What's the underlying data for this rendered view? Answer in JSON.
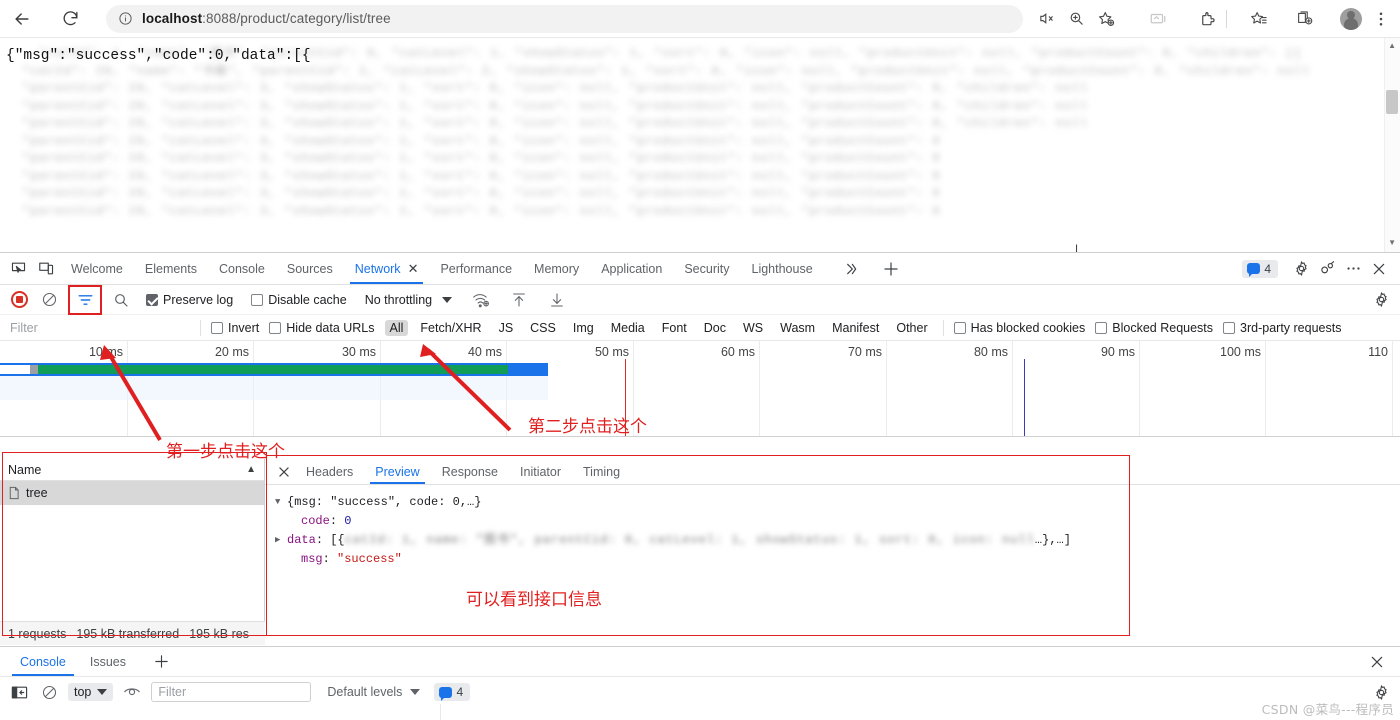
{
  "browser": {
    "back_icon": "back-arrow-icon",
    "reload_icon": "reload-icon",
    "address": {
      "info_icon": "info-circle-icon",
      "host": "localhost",
      "path": ":8088/product/category/list/tree",
      "full": "localhost:8088/product/category/list/tree"
    },
    "right_icons": [
      "read-aloud-icon",
      "zoom-icon",
      "add-favorite-icon",
      "collections-icon",
      "extensions-icon",
      "favorites-icon",
      "browser-essentials-icon",
      "profile-avatar-icon",
      "settings-more-icon"
    ]
  },
  "page": {
    "json_first_line": "{\"msg\":\"success\",\"code\":0,\"data\":[{",
    "blurred_lines": [
      "  \"catId\": 1, \"name\": \"图书\", \"parentCid\": 0, \"catLevel\": 1, \"showStatus\": 1, \"sort\": 0, \"icon\": null, \"productUnit\": null, \"productCount\": 0, \"children\": [{",
      "  \"catId\": 20, \"name\": \"书籍\", \"parentCid\": 1, \"catLevel\": 2, \"showStatus\": 1, \"sort\": 0, \"icon\": null, \"productUnit\": null, \"productCount\": 0, \"children\": null",
      "  \"parentCid\": 20, \"catLevel\": 3, \"showStatus\": 1, \"sort\": 0, \"icon\": null, \"productUnit\": null, \"productCount\": 0, \"children\": null",
      "  \"parentCid\": 20, \"catLevel\": 3, \"showStatus\": 1, \"sort\": 0, \"icon\": null, \"productUnit\": null, \"productCount\": 0, \"children\": null",
      "  \"parentCid\": 20, \"catLevel\": 3, \"showStatus\": 1, \"sort\": 0, \"icon\": null, \"productUnit\": null, \"productCount\": 0, \"children\": null",
      "  \"parentCid\": 20, \"catLevel\": 3, \"showStatus\": 1, \"sort\": 0, \"icon\": null, \"productUnit\": null, \"productCount\": 0",
      "  \"parentCid\": 20, \"catLevel\": 3, \"showStatus\": 1, \"sort\": 0, \"icon\": null, \"productUnit\": null, \"productCount\": 0",
      "  \"parentCid\": 20, \"catLevel\": 3, \"showStatus\": 1, \"sort\": 0, \"icon\": null, \"productUnit\": null, \"productCount\": 0",
      "  \"parentCid\": 20, \"catLevel\": 3, \"showStatus\": 1, \"sort\": 0, \"icon\": null, \"productUnit\": null, \"productCount\": 0",
      "  \"parentCid\": 20, \"catLevel\": 3, \"showStatus\": 1, \"sort\": 0, \"icon\": null, \"productUnit\": null, \"productCount\": 0"
    ]
  },
  "devtools": {
    "tabs": [
      {
        "label": "Welcome",
        "active": false,
        "closable": false
      },
      {
        "label": "Elements",
        "active": false,
        "closable": false
      },
      {
        "label": "Console",
        "active": false,
        "closable": false
      },
      {
        "label": "Sources",
        "active": false,
        "closable": false
      },
      {
        "label": "Network",
        "active": true,
        "closable": true
      },
      {
        "label": "Performance",
        "active": false,
        "closable": false
      },
      {
        "label": "Memory",
        "active": false,
        "closable": false
      },
      {
        "label": "Application",
        "active": false,
        "closable": false
      },
      {
        "label": "Security",
        "active": false,
        "closable": false
      },
      {
        "label": "Lighthouse",
        "active": false,
        "closable": false
      }
    ],
    "more_tabs_icon": "chevron-double-right-icon",
    "add_tab_icon": "plus-icon",
    "issues_count": "4",
    "settings_icon": "gear-icon",
    "customize_icon": "customize-devtools-icon",
    "more_icon": "more-options-icon",
    "close_icon": "close-icon",
    "inspect_icon": "inspect-element-icon",
    "device_icon": "toggle-device-toolbar-icon"
  },
  "network_toolbar": {
    "record_icon": "record-stop-icon",
    "clear_icon": "clear-icon",
    "filter_icon": "filter-icon",
    "search_icon": "search-icon",
    "preserve_log_label": "Preserve log",
    "preserve_log_checked": true,
    "disable_cache_label": "Disable cache",
    "disable_cache_checked": false,
    "throttling_value": "No throttling",
    "network_conditions_icon": "network-conditions-icon",
    "import_har_icon": "import-har-icon",
    "export_har_icon": "export-har-icon",
    "settings_icon": "network-settings-gear-icon"
  },
  "filter_bar": {
    "filter_placeholder": "Filter",
    "filter_value": "",
    "invert_label": "Invert",
    "invert_checked": false,
    "hide_data_urls_label": "Hide data URLs",
    "hide_data_urls_checked": false,
    "types": [
      "All",
      "Fetch/XHR",
      "JS",
      "CSS",
      "Img",
      "Media",
      "Font",
      "Doc",
      "WS",
      "Wasm",
      "Manifest",
      "Other"
    ],
    "selected_type": "All",
    "has_blocked_cookies_label": "Has blocked cookies",
    "has_blocked_cookies_checked": false,
    "blocked_requests_label": "Blocked Requests",
    "blocked_requests_checked": false,
    "third_party_label": "3rd-party requests",
    "third_party_checked": false
  },
  "overview": {
    "ticks": [
      "10 ms",
      "20 ms",
      "30 ms",
      "40 ms",
      "50 ms",
      "60 ms",
      "70 ms",
      "80 ms",
      "90 ms",
      "100 ms",
      "110"
    ],
    "bar_color": "#0f9d58",
    "bar_border_color": "#1a73e8",
    "dom_marker_color": "#d93025",
    "load_marker_color": "#3b3bb5"
  },
  "request_list": {
    "column_header": "Name",
    "sort_indicator": "▲",
    "rows": [
      {
        "name": "tree",
        "icon": "document-icon",
        "selected": true
      }
    ],
    "summary": {
      "requests": "1 requests",
      "transferred": "195 kB transferred",
      "resources": "195 kB res"
    }
  },
  "detail": {
    "close_icon": "close-icon",
    "tabs": [
      "Headers",
      "Preview",
      "Response",
      "Initiator",
      "Timing"
    ],
    "active_tab": "Preview",
    "preview": {
      "root_line": "{msg: \"success\", code: 0,…}",
      "rows": [
        {
          "key": "code",
          "value": "0",
          "value_type": "number"
        },
        {
          "key": "data",
          "value": "[{",
          "value_type": "array",
          "blurred": "catId: 1, name: \"图书\", parentCid: 0, catLevel: 1, showStatus: 1, sort: 0, icon: null",
          "tail": "…},…]"
        },
        {
          "key": "msg",
          "value": "\"success\"",
          "value_type": "string"
        }
      ]
    }
  },
  "annotations": [
    {
      "id": "step1",
      "text": "第一步点击这个"
    },
    {
      "id": "step2",
      "text": "第二步点击这个"
    },
    {
      "id": "step3",
      "text": "可以看到接口信息"
    }
  ],
  "drawer": {
    "tabs": [
      {
        "label": "Console",
        "active": true
      },
      {
        "label": "Issues",
        "active": false
      }
    ],
    "add_icon": "plus-icon",
    "close_icon": "close-icon",
    "toolbar": {
      "sidebar_icon": "show-console-sidebar-icon",
      "clear_icon": "clear-console-icon",
      "context": "top",
      "eye_icon": "live-expression-icon",
      "filter_placeholder": "Filter",
      "filter_value": "",
      "levels": "Default levels",
      "issues_count": "4",
      "settings_icon": "console-settings-gear-icon"
    }
  },
  "watermark": "CSDN @菜鸟---程序员",
  "colors": {
    "accent": "#1a73e8",
    "annotation_red": "#e02020",
    "record_red": "#d93025",
    "bar_green": "#0f9d58"
  }
}
